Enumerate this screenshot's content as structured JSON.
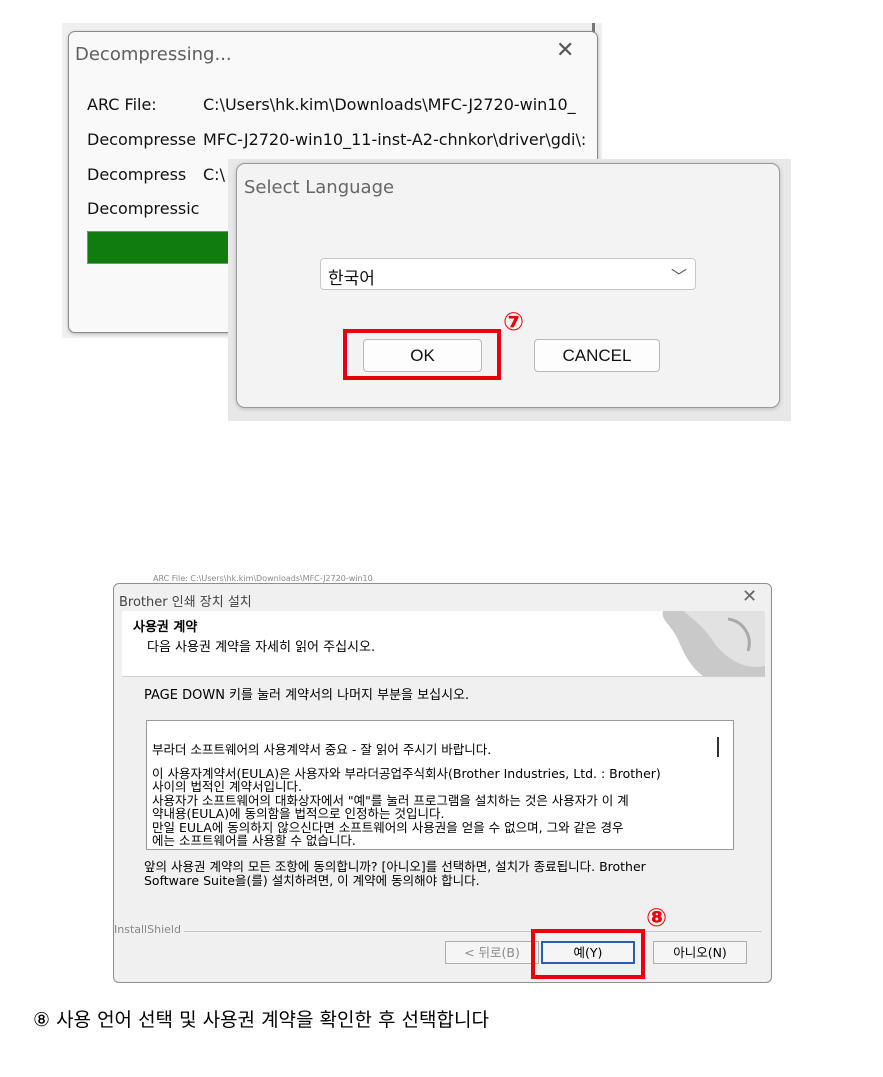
{
  "decompress_dialog": {
    "title": "Decompressing...",
    "rows": [
      {
        "label": "ARC File:",
        "value": "C:\\Users\\hk.kim\\Downloads\\MFC-J2720-win10_"
      },
      {
        "label": "Decompresse",
        "value": "MFC-J2720-win10_11-inst-A2-chnkor\\driver\\gdi\\:"
      },
      {
        "label": "Decompress",
        "value": "C:\\"
      },
      {
        "label": "Decompressic",
        "value": ""
      }
    ],
    "progress": 1.0,
    "progress_color": "#107c10"
  },
  "language_dialog": {
    "title": "Select Language",
    "selected_language": "한국어",
    "ok_label": "OK",
    "cancel_label": "CANCEL",
    "step_marker": "⑦"
  },
  "setup_window": {
    "title": "Brother 인쇄 장치 설치",
    "heading": "사용권 계약",
    "subheading": "다음 사용권 계약을 자세히 읽어 주십시오.",
    "instruction": "PAGE DOWN 키를 눌러 계약서의 나머지 부분을 보십시오.",
    "eula_lines": [
      "부라더 소프트웨어의 사용계약서   중요 - 잘 읽어 주시기 바랍니다.",
      "이 사용자계약서(EULA)은 사용자와 부라더공업주식회사(Brother Industries, Ltd. : Brother)",
      "사이의 법적인 계약서입니다.",
      "사용자가 소프트웨어의 대화상자에서 \"예\"를 눌러 프로그램을 설치하는 것은 사용자가 이 계",
      "약내용(EULA)에 동의함을 법적으로 인정하는 것입니다.",
      "만일 EULA에 동의하지 않으신다면 소프트웨어의 사용권을 얻을 수 없으며, 그와 같은 경우",
      "에는 소프트웨어를 사용할 수 없습니다."
    ],
    "agree_text_1": "앞의 사용권 계약의 모든 조항에 동의합니까? [아니오]를 선택하면, 설치가 종료됩니다. Brother",
    "agree_text_2": "Software Suite을(를) 설치하려면, 이 계약에 동의해야 합니다.",
    "installshield_label": "InstallShield",
    "back_label": "< 뒤로(B)",
    "yes_label": "예(Y)",
    "no_label": "아니오(N)",
    "step_marker": "⑧"
  },
  "caption": "⑧  사용 언어 선택 및 사용권 계약을 확인한 후 선택합니다",
  "colors": {
    "highlight": "#e8000c"
  }
}
